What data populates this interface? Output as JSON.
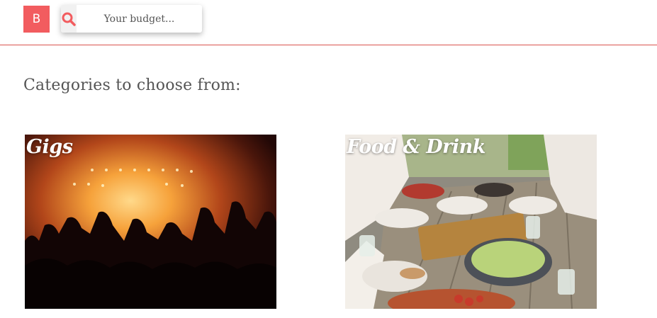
{
  "header": {
    "logo_text": "B",
    "search": {
      "placeholder": "Your budget...",
      "icon": "search-icon"
    }
  },
  "main": {
    "section_title": "Categories to choose from:",
    "categories": [
      {
        "title": "Gigs",
        "image": "concert-crowd-photo"
      },
      {
        "title": "Food & Drink",
        "image": "outdoor-dinner-table-photo"
      }
    ]
  },
  "colors": {
    "accent": "#f25c5f",
    "divider": "#d9534f",
    "text": "#555555"
  }
}
